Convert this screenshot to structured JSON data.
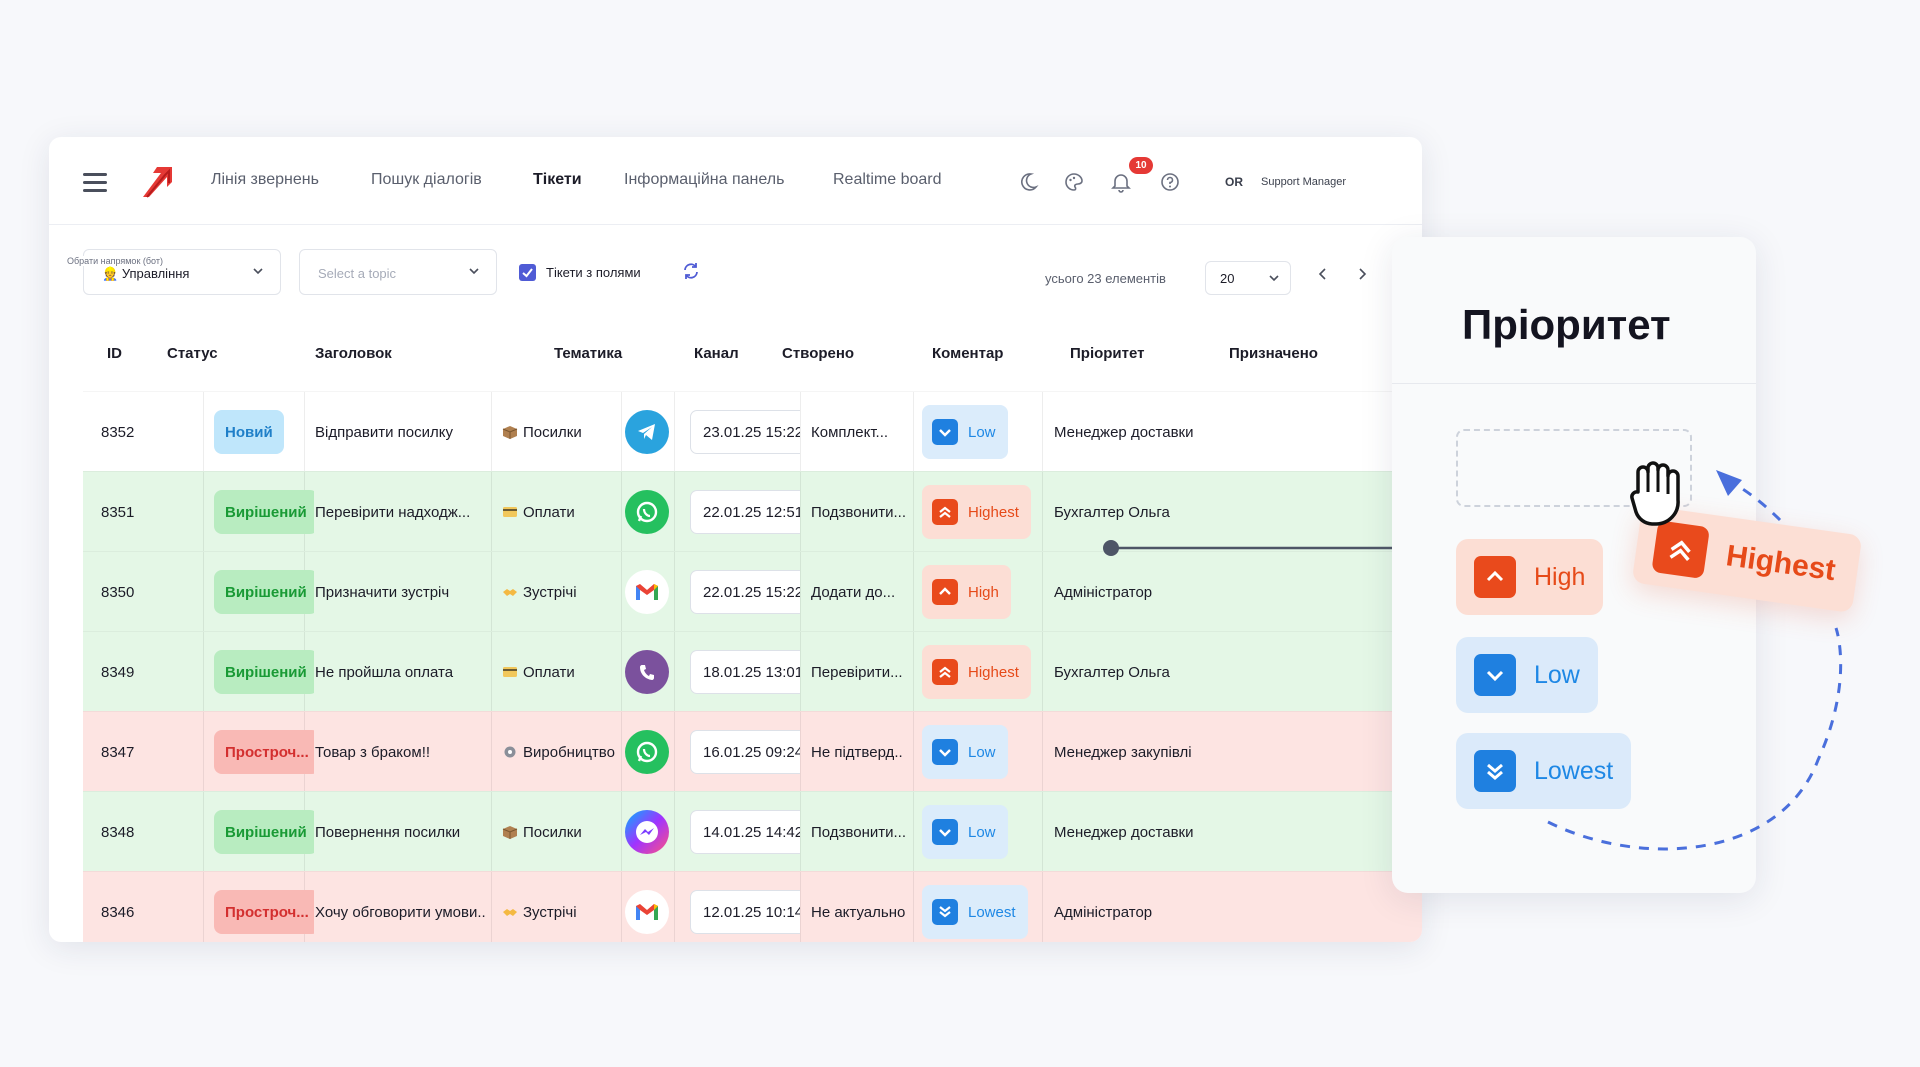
{
  "nav": {
    "items": [
      "Лінія звернень",
      "Пошук діалогів",
      "Тікети",
      "Інформаційна панель",
      "Realtime board"
    ],
    "active_index": 2,
    "notifications_count": "10",
    "user_initials": "OR",
    "user_role": "Support Manager"
  },
  "filters": {
    "direction_label": "Обрати напрямок (бот)",
    "direction_value": "Управління",
    "topic_placeholder": "Select a topic",
    "checkbox_label": "Тікети з полями",
    "checkbox_checked": true,
    "total_label": "усього 23 елементів",
    "page_size": "20"
  },
  "table": {
    "columns": [
      "ID",
      "Статус",
      "Заголовок",
      "Тематика",
      "Канал",
      "Створено",
      "Коментар",
      "Пріоритет",
      "Призначено"
    ],
    "rows": [
      {
        "id": "8352",
        "status": "Новий",
        "status_kind": "new",
        "title": "Відправити посилку",
        "theme": "Посилки",
        "theme_icon": "package-icon",
        "channel": "telegram",
        "created": "23.01.25 15:22",
        "comment": "Комплект...",
        "priority": "Low",
        "assignee": "Менеджер доставки",
        "tone": "white"
      },
      {
        "id": "8351",
        "status": "Вирішений",
        "status_kind": "done",
        "title": "Перевірити надходж...",
        "theme": "Оплати",
        "theme_icon": "card-icon",
        "channel": "whatsapp",
        "created": "22.01.25 12:51",
        "comment": "Подзвонити...",
        "priority": "Highest",
        "assignee": "Бухгалтер Ольга",
        "tone": "green"
      },
      {
        "id": "8350",
        "status": "Вирішений",
        "status_kind": "done",
        "title": "Призначити зустріч",
        "theme": "Зустрічі",
        "theme_icon": "handshake-icon",
        "channel": "gmail",
        "created": "22.01.25 15:22",
        "comment": "Додати до...",
        "priority": "High",
        "assignee": "Адміністратор",
        "tone": "green"
      },
      {
        "id": "8349",
        "status": "Вирішений",
        "status_kind": "done",
        "title": "Не пройшла оплата",
        "theme": "Оплати",
        "theme_icon": "card-icon",
        "channel": "viber",
        "created": "18.01.25 13:01",
        "comment": "Перевірити...",
        "priority": "Highest",
        "assignee": "Бухгалтер Ольга",
        "tone": "green"
      },
      {
        "id": "8347",
        "status": "Простроч...",
        "status_kind": "over",
        "title": "Товар з браком!!",
        "theme": "Виробництво",
        "theme_icon": "gear-icon",
        "channel": "whatsapp",
        "created": "16.01.25 09:24",
        "comment": "Не підтверд..",
        "priority": "Low",
        "assignee": "Менеджер закупівлі",
        "tone": "red"
      },
      {
        "id": "8348",
        "status": "Вирішений",
        "status_kind": "done",
        "title": "Повернення посилки",
        "theme": "Посилки",
        "theme_icon": "package-icon",
        "channel": "messenger",
        "created": "14.01.25 14:42",
        "comment": "Подзвонити...",
        "priority": "Low",
        "assignee": "Менеджер доставки",
        "tone": "green"
      },
      {
        "id": "8346",
        "status": "Простроч...",
        "status_kind": "over",
        "title": "Хочу обговорити умови...",
        "theme": "Зустрічі",
        "theme_icon": "handshake-icon",
        "channel": "gmail",
        "created": "12.01.25 10:14",
        "comment": "Не актуально",
        "priority": "Lowest",
        "assignee": "Адміністратор",
        "tone": "red"
      }
    ]
  },
  "panel": {
    "title": "Пріоритет",
    "options": [
      "High",
      "Low",
      "Lowest"
    ],
    "dragging": "Highest"
  },
  "colors": {
    "accent_blue": "#1f80e0",
    "accent_orange": "#e94a1c",
    "row_green": "#e4f7e6",
    "row_red": "#fde4e2"
  }
}
